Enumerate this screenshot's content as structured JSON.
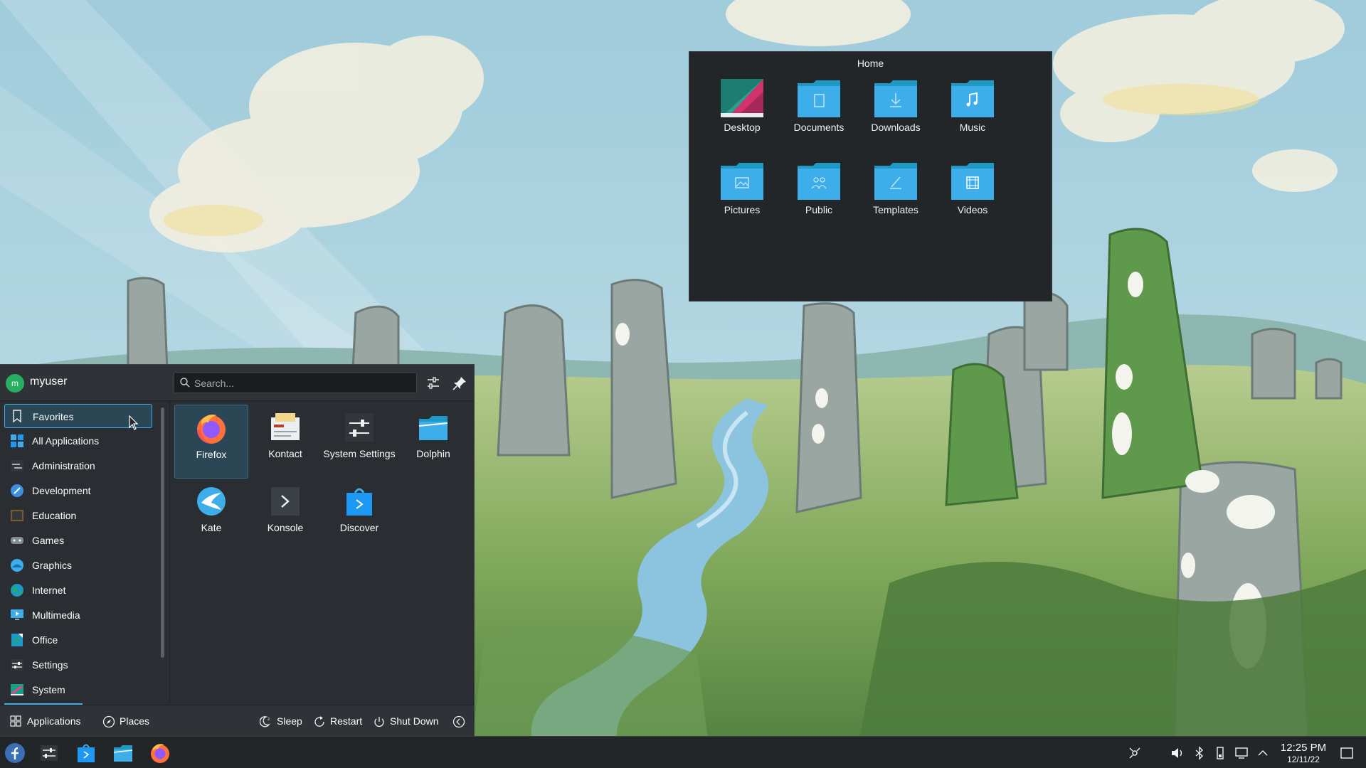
{
  "folder_view": {
    "title": "Home",
    "items": [
      {
        "label": "Desktop",
        "icon": "desktop-icon"
      },
      {
        "label": "Documents",
        "icon": "folder-documents-icon"
      },
      {
        "label": "Downloads",
        "icon": "folder-downloads-icon"
      },
      {
        "label": "Music",
        "icon": "folder-music-icon"
      },
      {
        "label": "Pictures",
        "icon": "folder-pictures-icon"
      },
      {
        "label": "Public",
        "icon": "folder-public-icon"
      },
      {
        "label": "Templates",
        "icon": "folder-templates-icon"
      },
      {
        "label": "Videos",
        "icon": "folder-videos-icon"
      }
    ]
  },
  "launcher": {
    "user": {
      "name": "myuser",
      "avatar_letter": "m"
    },
    "search": {
      "placeholder": "Search..."
    },
    "categories": [
      {
        "label": "Favorites",
        "active": true,
        "icon": "bookmark-icon"
      },
      {
        "label": "All Applications",
        "icon": "grid-icon"
      },
      {
        "label": "Administration",
        "icon": "admin-icon"
      },
      {
        "label": "Development",
        "icon": "development-icon"
      },
      {
        "label": "Education",
        "icon": "education-icon"
      },
      {
        "label": "Games",
        "icon": "gamepad-icon"
      },
      {
        "label": "Graphics",
        "icon": "graphics-icon"
      },
      {
        "label": "Internet",
        "icon": "globe-icon"
      },
      {
        "label": "Multimedia",
        "icon": "multimedia-icon"
      },
      {
        "label": "Office",
        "icon": "office-icon"
      },
      {
        "label": "Settings",
        "icon": "settings-icon"
      },
      {
        "label": "System",
        "icon": "system-icon"
      }
    ],
    "favorites": [
      {
        "label": "Firefox",
        "icon": "firefox-icon"
      },
      {
        "label": "Kontact",
        "icon": "kontact-icon"
      },
      {
        "label": "System Settings",
        "icon": "system-settings-icon"
      },
      {
        "label": "Dolphin",
        "icon": "dolphin-icon"
      },
      {
        "label": "Kate",
        "icon": "kate-icon"
      },
      {
        "label": "Konsole",
        "icon": "konsole-icon"
      },
      {
        "label": "Discover",
        "icon": "discover-icon"
      }
    ],
    "footer": {
      "applications": "Applications",
      "places": "Places",
      "sleep": "Sleep",
      "restart": "Restart",
      "shutdown": "Shut Down"
    }
  },
  "taskbar": {
    "clock": {
      "time": "12:25 PM",
      "date": "12/11/22"
    }
  },
  "colors": {
    "accent": "#3daee9",
    "panel": "#232629",
    "launcher_bg": "#2a2e32"
  }
}
